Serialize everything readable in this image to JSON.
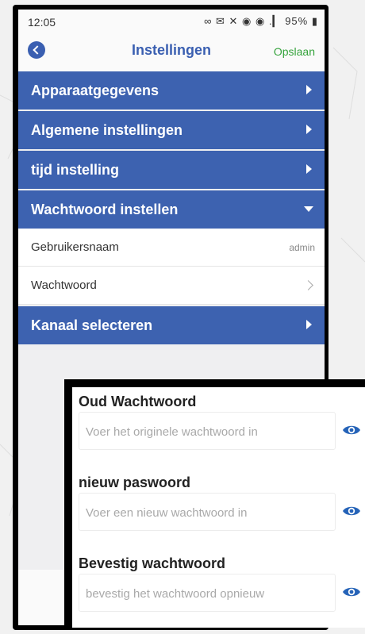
{
  "status_bar": {
    "time": "12:05",
    "battery": "95%",
    "icons": "∞ ✉ ✕ ◉ ◉ .▎"
  },
  "nav": {
    "title": "Instellingen",
    "save_label": "Opslaan"
  },
  "sections": [
    {
      "label": "Apparaatgegevens",
      "expanded": false
    },
    {
      "label": "Algemene instellingen",
      "expanded": false
    },
    {
      "label": "tijd instelling",
      "expanded": false
    },
    {
      "label": "Wachtwoord instellen",
      "expanded": true
    },
    {
      "label": "Kanaal selecteren",
      "expanded": false
    }
  ],
  "password_rows": [
    {
      "label": "Gebruikersnaam",
      "value": "admin"
    },
    {
      "label": "Wachtwoord"
    }
  ],
  "password_dialog": {
    "fields": [
      {
        "title": "Oud Wachtwoord",
        "placeholder": "Voer het originele wachtwoord in"
      },
      {
        "title": "nieuw paswoord",
        "placeholder": "Voer een nieuw wachtwoord in"
      },
      {
        "title": "Bevestig wachtwoord",
        "placeholder": "bevestig het wachtwoord opnieuw"
      }
    ]
  },
  "colors": {
    "accent": "#3d62b0",
    "save": "#35a33c",
    "eye": "#2563b8"
  },
  "icons": [
    "back-icon",
    "chevron-right-icon",
    "caret-down-icon",
    "eye-icon"
  ]
}
